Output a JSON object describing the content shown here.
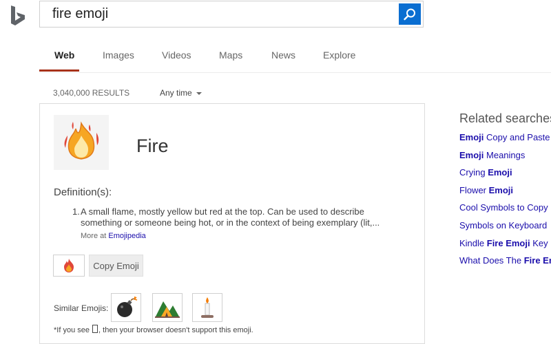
{
  "search": {
    "query": "fire emoji"
  },
  "tabs": [
    "Web",
    "Images",
    "Videos",
    "Maps",
    "News",
    "Explore"
  ],
  "results": {
    "count": "3,040,000 RESULTS",
    "time_filter": "Any time"
  },
  "emoji_card": {
    "name": "Fire",
    "definition_heading": "Definition(s):",
    "definition_number": "1.",
    "definition_text": "A small flame, mostly yellow but red at the top. Can be used to describe something or someone being hot, or in the context of being exemplary (lit,...",
    "more_at_prefix": "More at",
    "more_at_link": "Emojipedia",
    "copy_label": "Copy Emoji",
    "similar_label": "Similar Emojis:",
    "similar_icons": [
      "bomb-icon",
      "camping-icon",
      "candle-icon"
    ],
    "footnote_prefix": "*If you see",
    "footnote_suffix": ", then your browser doesn't support this emoji."
  },
  "related": {
    "heading": "Related searches",
    "items": [
      {
        "bold_first": true,
        "bold": "Emoji",
        "text": " Copy and Paste"
      },
      {
        "bold_first": true,
        "bold": "Emoji",
        "text": " Meanings"
      },
      {
        "bold_first": false,
        "text": "Crying ",
        "bold": "Emoji"
      },
      {
        "bold_first": false,
        "text": "Flower ",
        "bold": "Emoji"
      },
      {
        "bold_first": false,
        "text": "Cool Symbols to Copy",
        "bold": ""
      },
      {
        "bold_first": false,
        "text": "Symbols on Keyboard",
        "bold": ""
      },
      {
        "bold_first": false,
        "text": "Kindle ",
        "bold": "Fire Emoji",
        "after": " Key"
      },
      {
        "bold_first": false,
        "text": "What Does The ",
        "bold": "Fire En",
        "after": ""
      }
    ]
  },
  "colors": {
    "accent_underline": "#a8321a",
    "link": "#1a0dab",
    "search_button": "#0a6ed1"
  }
}
